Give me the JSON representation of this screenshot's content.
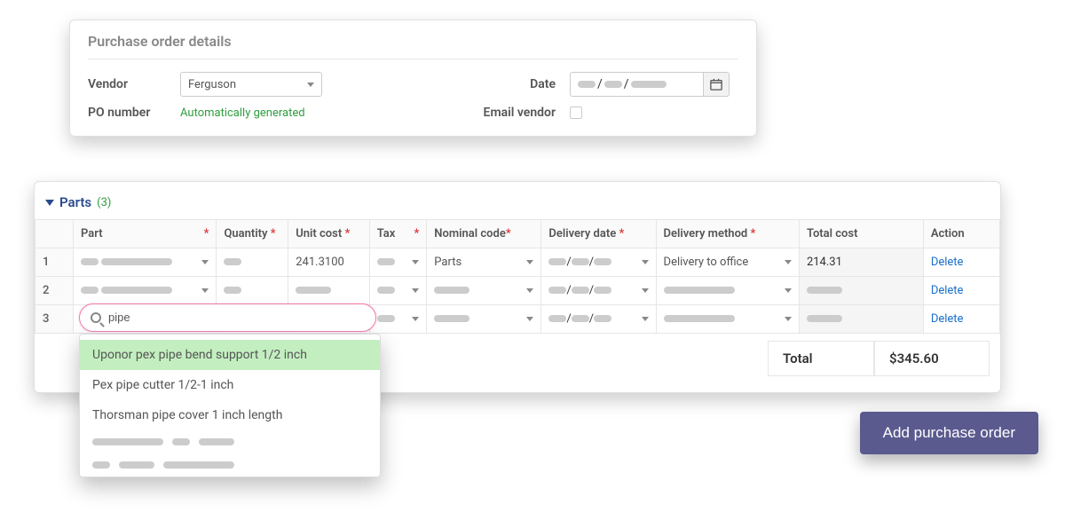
{
  "details": {
    "title": "Purchase order details",
    "vendor_label": "Vendor",
    "vendor_value": "Ferguson",
    "po_label": "PO number",
    "po_value": "Automatically generated",
    "date_label": "Date",
    "email_label": "Email vendor"
  },
  "parts": {
    "title": "Parts",
    "count": "(3)",
    "headers": {
      "part": "Part",
      "qty": "Quantity",
      "unit": "Unit cost",
      "tax": "Tax",
      "nominal": "Nominal code",
      "deld": "Delivery date",
      "delm": "Delivery method",
      "total": "Total cost",
      "action": "Action"
    },
    "rows": [
      {
        "n": "1",
        "unit": "241.3100",
        "nominal": "Parts",
        "delm": "Delivery to office",
        "total": "214.31",
        "action": "Delete"
      },
      {
        "n": "2",
        "action": "Delete"
      },
      {
        "n": "3",
        "action": "Delete"
      }
    ],
    "total_label": "Total",
    "total_value": "$345.60"
  },
  "search": {
    "query": "pipe",
    "options": [
      "Uponor pex pipe bend support 1/2 inch",
      "Pex pipe cutter 1/2-1 inch",
      "Thorsman pipe cover 1 inch length"
    ]
  },
  "cta": "Add purchase order"
}
